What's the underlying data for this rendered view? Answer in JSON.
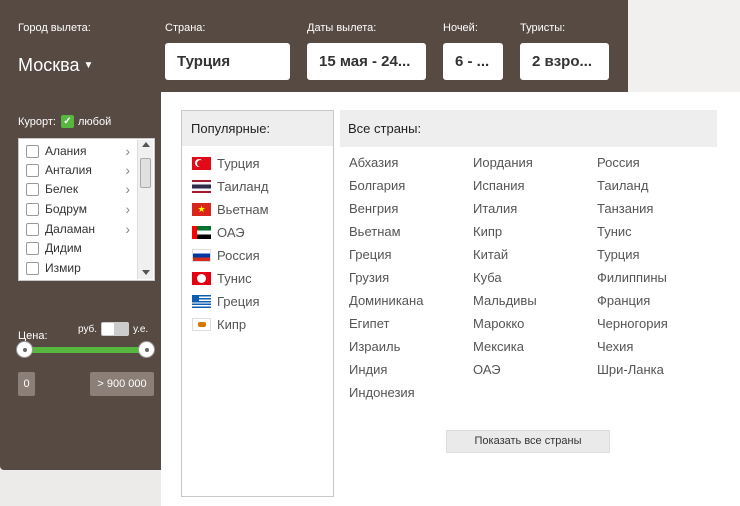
{
  "search": {
    "city_label": "Город вылета:",
    "city_value": "Москва",
    "country_label": "Страна:",
    "country_value": "Турция",
    "dates_label": "Даты вылета:",
    "dates_value": "15 мая - 24...",
    "nights_label": "Ночей:",
    "nights_value": "6 - ...",
    "tourists_label": "Туристы:",
    "tourists_value": "2 взро..."
  },
  "resort": {
    "label": "Курорт:",
    "any_label": "любой",
    "any_checked": true,
    "items": [
      {
        "label": "Алания",
        "has_submenu": true
      },
      {
        "label": "Анталия",
        "has_submenu": true
      },
      {
        "label": "Белек",
        "has_submenu": true
      },
      {
        "label": "Бодрум",
        "has_submenu": true
      },
      {
        "label": "Даламан",
        "has_submenu": true
      },
      {
        "label": "Дидим",
        "has_submenu": false
      },
      {
        "label": "Измир",
        "has_submenu": false
      }
    ]
  },
  "price": {
    "label": "Цена:",
    "currency_left": "руб.",
    "currency_right": "у.е.",
    "min_value": "0",
    "max_value": "> 900 000"
  },
  "popular": {
    "heading": "Популярные:",
    "items": [
      {
        "label": "Турция",
        "flag": "flag-turkey"
      },
      {
        "label": "Таиланд",
        "flag": "flag-thailand"
      },
      {
        "label": "Вьетнам",
        "flag": "flag-vietnam"
      },
      {
        "label": "ОАЭ",
        "flag": "flag-uae"
      },
      {
        "label": "Россия",
        "flag": "flag-russia"
      },
      {
        "label": "Тунис",
        "flag": "flag-tunisia"
      },
      {
        "label": "Греция",
        "flag": "flag-greece"
      },
      {
        "label": "Кипр",
        "flag": "flag-cyprus"
      }
    ]
  },
  "all_countries": {
    "heading": "Все страны:",
    "columns": [
      [
        "Абхазия",
        "Болгария",
        "Венгрия",
        "Вьетнам",
        "Греция",
        "Грузия",
        "Доминикана",
        "Египет",
        "Израиль",
        "Индия",
        "Индонезия"
      ],
      [
        "Иордания",
        "Испания",
        "Италия",
        "Кипр",
        "Китай",
        "Куба",
        "Мальдивы",
        "Марокко",
        "Мексика",
        "ОАЭ"
      ],
      [
        "Россия",
        "Таиланд",
        "Танзания",
        "Тунис",
        "Турция",
        "Филиппины",
        "Франция",
        "Черногория",
        "Чехия",
        "Шри-Ланка"
      ]
    ],
    "show_all_label": "Показать все страны"
  },
  "colors": {
    "panel": "#574a42",
    "accent_green": "#56b83e"
  }
}
